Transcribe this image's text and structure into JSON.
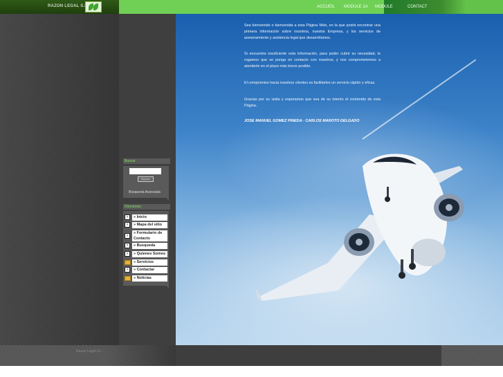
{
  "site": {
    "brand": "RAZON LEGAL S.L",
    "logo_icon": "leaf-logo-icon"
  },
  "nav": [
    "ACCUEIL",
    "MODULE 1A",
    "MODULE",
    "CONTACT"
  ],
  "content": {
    "paragraphs": [
      "Sea bienvenido o bienvenida a esta Página Web, en la que podrá encontrar una primera información sobre nosotros, nuestra Empresa, y los servicios de asesoramiento y asistencia legal que desarrollamos.",
      "Si encuentra insuficiente esta información, para poder cubrir su necesidad, le rogamos que se ponga en contacto con nosotros, y nos comprometemos a atenderle en el plazo más breve posible.",
      "El compromiso hacia nuestros clientes es facilitarles un servicio rápido y eficaz.",
      "Gracias por su visita y esperamos que sea de su interés el contenido de esta Página."
    ],
    "signature": "JOSE MANUEL GOMEZ PINEDA - CARLOS MAROTO DELGADO"
  },
  "search": {
    "title": "Buscar",
    "input_value": "",
    "button_label": "Buscar",
    "advanced_link": "Búsqueda Avanzada"
  },
  "menu": {
    "title": "Directorios",
    "items": [
      {
        "label": "» Inicio",
        "icon": "arrow-icon"
      },
      {
        "label": "» Mapa del sitio",
        "icon": "arrow-icon"
      },
      {
        "label": "» Formulario de Contacto",
        "icon": "arrow-icon"
      },
      {
        "label": "» Busqueda",
        "icon": "arrow-icon"
      },
      {
        "label": "» Quienes Somos",
        "icon": "arrow-icon"
      },
      {
        "label": "» Servicios",
        "icon": "folder-icon"
      },
      {
        "label": "» Contactar",
        "icon": "arrow-icon"
      },
      {
        "label": "» Noticias",
        "icon": "folder-icon"
      }
    ]
  },
  "footer": {
    "text": "Razon Legal S.L"
  },
  "colors": {
    "nav_green": "#6fd055",
    "accent_green": "#7fe35a"
  }
}
